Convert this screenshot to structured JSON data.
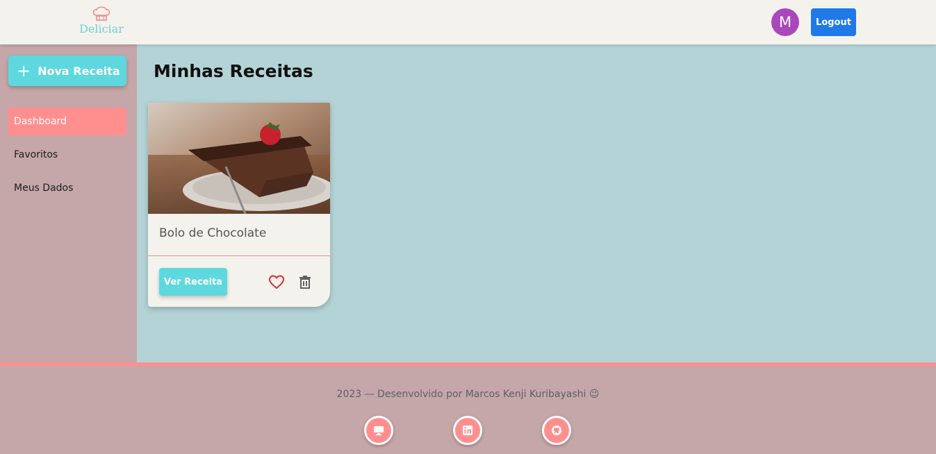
{
  "header": {
    "logo_text": "Deliciar",
    "logo_icon": "chef-hat-icon",
    "avatar_letter": "M",
    "logout_label": "Logout"
  },
  "sidebar": {
    "new_recipe_label": "Nova Receita",
    "items": [
      {
        "label": "Dashboard",
        "active": true
      },
      {
        "label": "Favoritos",
        "active": false
      },
      {
        "label": "Meus Dados",
        "active": false
      }
    ]
  },
  "main": {
    "title": "Minhas Receitas",
    "recipes": [
      {
        "title": "Bolo de Chocolate",
        "view_label": "Ver Receita",
        "image": "chocolate-cake-photo",
        "favorite_icon": "heart-outline-icon",
        "delete_icon": "trash-icon"
      }
    ]
  },
  "footer": {
    "text": "2023 — Desenvolvido por Marcos Kenji Kuribayashi 😉",
    "links": [
      "monitor-icon",
      "linkedin-icon",
      "github-icon"
    ]
  },
  "colors": {
    "accent_teal": "#5ed8df",
    "accent_pink": "#ff8f8f",
    "sidebar_bg": "#c5a6a9",
    "main_bg": "#b4d3d6",
    "header_bg": "#f4f2ed",
    "logout_blue": "#1f7ae8",
    "avatar_purple": "#ab47bc"
  }
}
